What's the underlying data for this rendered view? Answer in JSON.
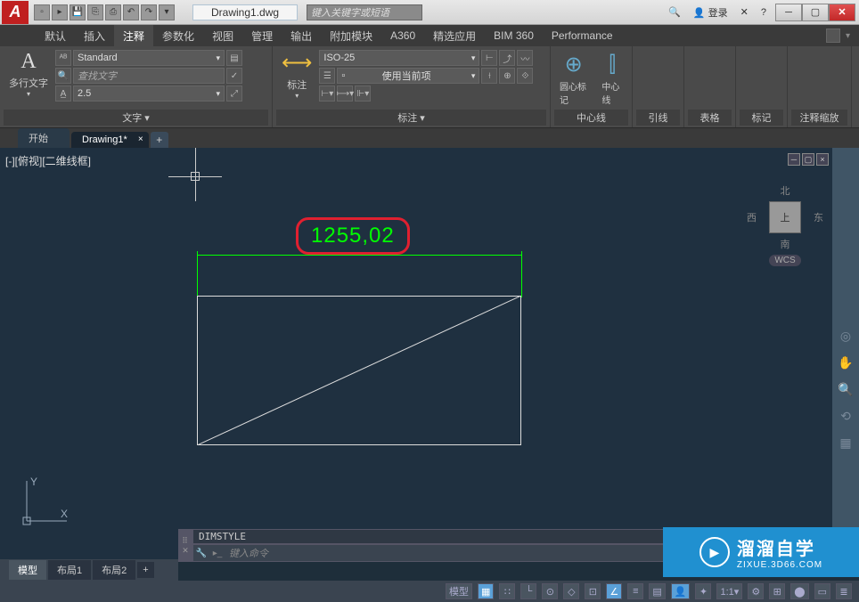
{
  "title": {
    "doc": "Drawing1.dwg",
    "search_ph": "键入关键字或短语",
    "login": "登录"
  },
  "menu": [
    "默认",
    "插入",
    "注释",
    "参数化",
    "视图",
    "管理",
    "输出",
    "附加模块",
    "A360",
    "精选应用",
    "BIM 360",
    "Performance"
  ],
  "menu_active_index": 2,
  "ribbon": {
    "text_panel": {
      "big": "多行文字",
      "title": "文字 ▾",
      "style": "Standard",
      "search_ph": "查找文字",
      "height": "2.5"
    },
    "dim_panel": {
      "big": "标注",
      "title": "标注 ▾",
      "style": "ISO-25",
      "layer": "使用当前项"
    },
    "center_panel": {
      "btn1": "圆心标记",
      "btn2": "中心线",
      "title": "中心线"
    },
    "leader": "引线",
    "table": "表格",
    "markup": "标记",
    "annoscale": "注释缩放"
  },
  "doctabs": {
    "start": "开始",
    "drawing": "Drawing1*"
  },
  "viewport_label": "[-][俯视][二维线框]",
  "dimension_value": "1255,02",
  "viewcube": {
    "n": "北",
    "s": "南",
    "e": "东",
    "w": "西",
    "face": "上",
    "wcs": "WCS"
  },
  "ucs": {
    "y": "Y",
    "x": "X"
  },
  "cmd": {
    "history": "DIMSTYLE",
    "placeholder": "键入命令"
  },
  "layout": {
    "model": "模型",
    "l1": "布局1",
    "l2": "布局2"
  },
  "status": {
    "model": "模型"
  },
  "watermark": {
    "main": "溜溜自学",
    "sub": "ZIXUE.3D66.COM"
  }
}
